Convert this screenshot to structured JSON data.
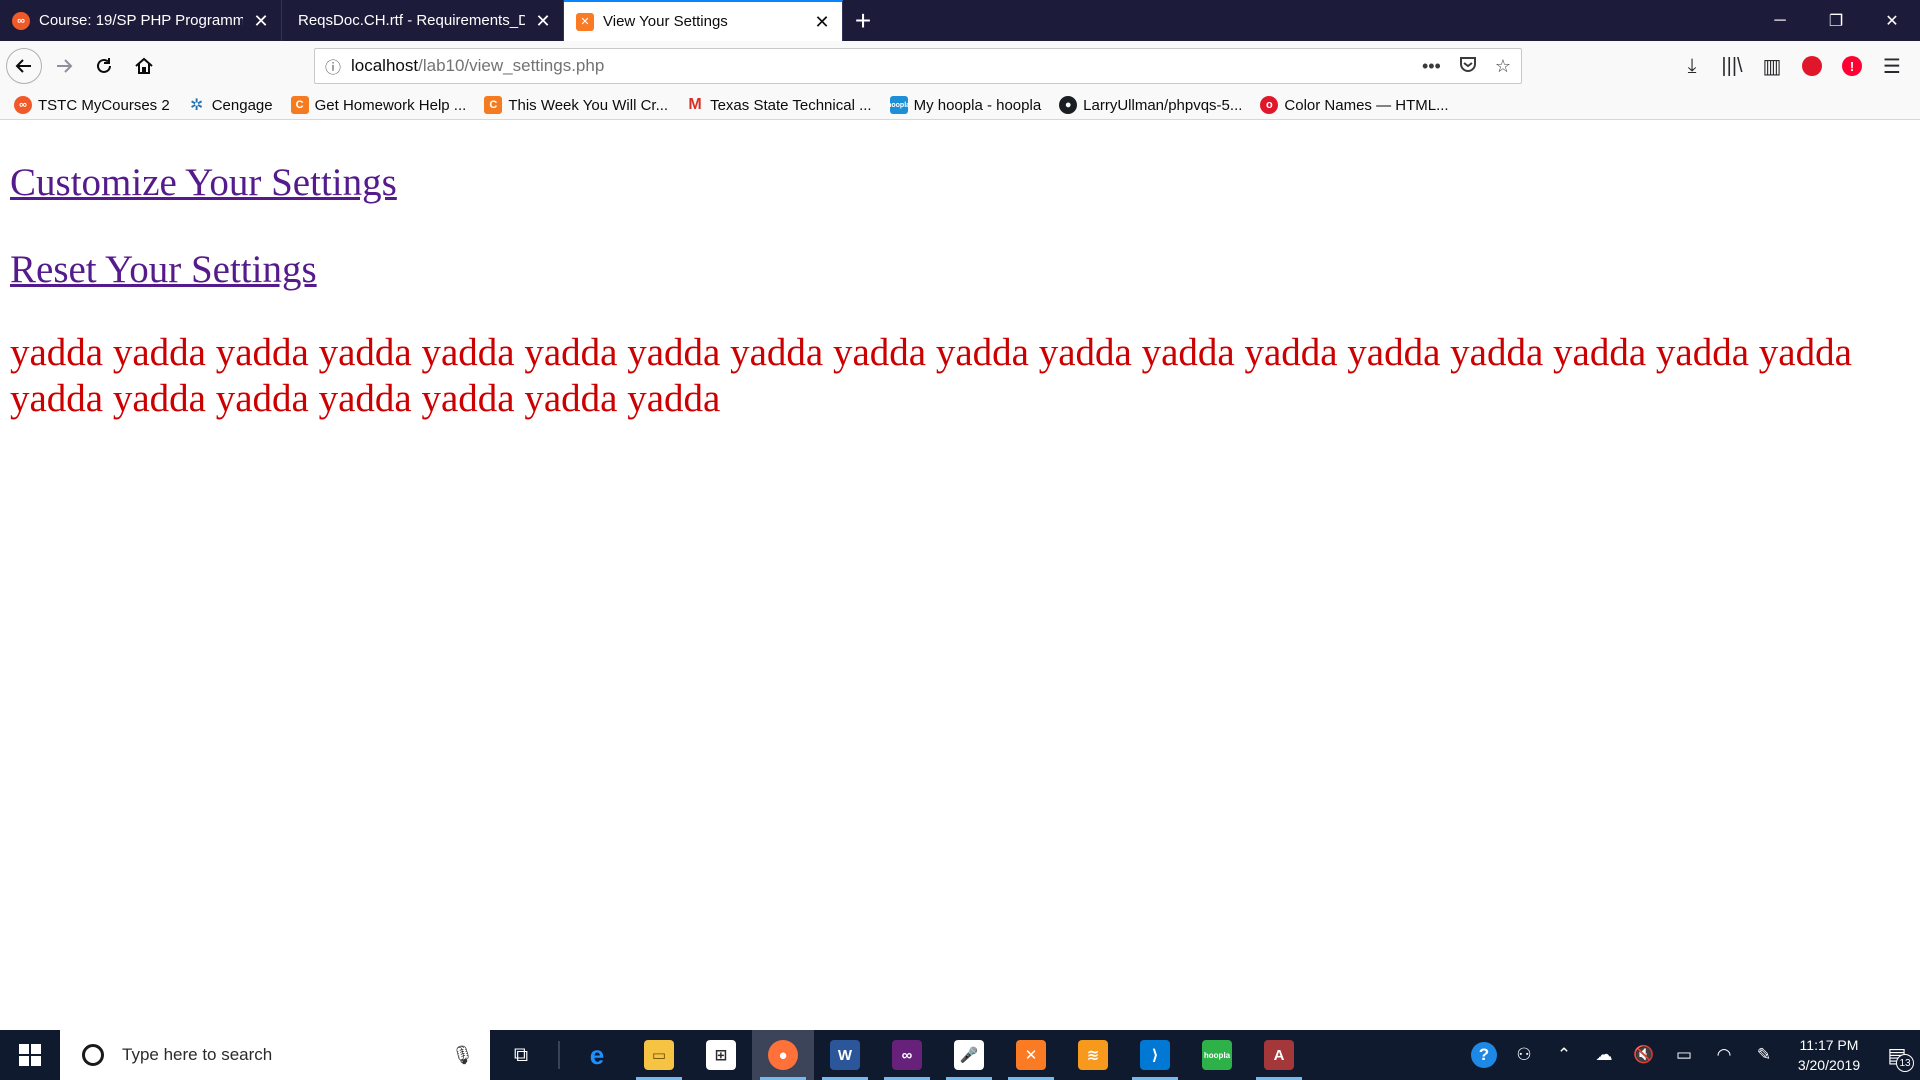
{
  "tabs": [
    {
      "label": "Course: 19/SP PHP Programming",
      "favicon": "moodle-icon",
      "active": false
    },
    {
      "label": "ReqsDoc.CH.rtf - Requirements_Doc",
      "favicon": "none",
      "active": false
    },
    {
      "label": "View Your Settings",
      "favicon": "xampp-icon",
      "active": true
    }
  ],
  "url": {
    "host": "localhost",
    "path": "/lab10/view_settings.php"
  },
  "bookmarks": [
    {
      "label": "TSTC MyCourses 2",
      "icon": "moodle-icon"
    },
    {
      "label": "Cengage",
      "icon": "cengage-icon"
    },
    {
      "label": "Get Homework Help ...",
      "icon": "chegg-icon"
    },
    {
      "label": "This Week You Will Cr...",
      "icon": "chegg-icon"
    },
    {
      "label": "Texas State Technical ...",
      "icon": "gmail-icon"
    },
    {
      "label": "My hoopla - hoopla",
      "icon": "hoopla-icon"
    },
    {
      "label": "LarryUllman/phpvqs-5...",
      "icon": "github-icon"
    },
    {
      "label": "Color Names — HTML...",
      "icon": "opera-icon"
    }
  ],
  "page": {
    "link_customize": "Customize Your Settings",
    "link_reset": "Reset Your Settings",
    "body_text": "yadda yadda yadda yadda yadda yadda yadda yadda yadda yadda yadda yadda yadda yadda yadda yadda yadda yadda yadda yadda yadda yadda yadda yadda yadda"
  },
  "taskbar": {
    "search_placeholder": "Type here to search",
    "clock_time": "11:17 PM",
    "clock_date": "3/20/2019",
    "notification_count": "13"
  },
  "colors": {
    "link": "#551a8b",
    "body_text": "#cc0000",
    "titlebar": "#1d1b3a",
    "accent": "#0a84ff"
  }
}
